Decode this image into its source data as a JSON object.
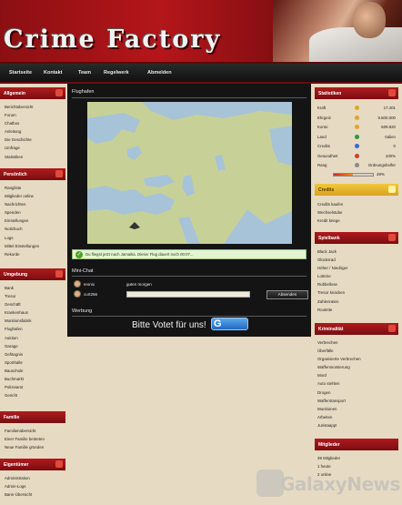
{
  "header": {
    "logo": "Crime Factory"
  },
  "nav": [
    "Startseite",
    "Kontakt",
    "Team",
    "Regelwerk",
    "Abmelden"
  ],
  "left": {
    "allgemein": {
      "title": "Allgemein",
      "items": [
        "Berichtübersicht",
        "Forum",
        "Chatbox",
        "Anleitung",
        "Die Geschichte",
        "Umfrage",
        "Statistiken"
      ]
    },
    "persoenlich": {
      "title": "Persönlich",
      "items": [
        "Rangliste",
        "Mitglieder online",
        "Nachrichten",
        "Spenden",
        "Einstellungen",
        "Notizbuch",
        "Logs",
        "Mittel Einstellungen",
        "Rekorde"
      ]
    },
    "umgebung": {
      "title": "Umgebung",
      "items": [
        "Bank",
        "Tresor",
        "Geschäft",
        "Krankenhaus",
        "Munitionsfabrik",
        "Flughafen",
        "Auktion",
        "Garage",
        "Gefängnis",
        "Sporthalle",
        "Bauschule",
        "Buchmarkt",
        "Polizeiamt",
        "Gericht"
      ]
    },
    "familie": {
      "title": "Familie",
      "items": [
        "Familienübersicht",
        "Einer Familie beitreten",
        "Neue Familie gründen"
      ]
    },
    "eigentuemer": {
      "title": "Eigentümer",
      "items": [
        "Administration",
        "Admin-Logs",
        "Bann-Übersicht"
      ]
    }
  },
  "center": {
    "flughafen_title": "Flughafen",
    "notice": "Du fliegst jetzt nach Jamaika. Dieser Flug dauert noch 00:07...",
    "minichat_title": "Mini-Chat",
    "chat": [
      {
        "user": "Ieonix",
        "message": "guten morgen"
      },
      {
        "user": "curt256",
        "message": ""
      }
    ],
    "send_label": "Absenden",
    "werbung_title": "Werbung",
    "vote_text": "Bitte Votet für uns!",
    "vote_badge": "G"
  },
  "right": {
    "statistiken": {
      "title": "Statistiken",
      "rows": [
        {
          "label": "Kraft",
          "value": "17.401",
          "icon_color": "#e0a820"
        },
        {
          "label": "Ehrgeiz",
          "value": "9.500.000",
          "icon_color": "#e0a820"
        },
        {
          "label": "Konto",
          "value": "609.820",
          "icon_color": "#e0a820"
        },
        {
          "label": "Land",
          "value": "Italien",
          "icon_color": "#2a9a3a"
        },
        {
          "label": "Credits",
          "value": "0",
          "icon_color": "#3a6ad0"
        },
        {
          "label": "Gesundheit",
          "value": "100%",
          "icon_color": "#d23a3a"
        },
        {
          "label": "Rang",
          "value": "Ordnungshelfer",
          "icon_color": "#8a8a8a"
        }
      ],
      "progress_label": "49%",
      "progress_value": 0.49
    },
    "credits": {
      "title": "Credits",
      "items": [
        "Credits kaufen",
        "Wechselstube",
        "Kredit kriege"
      ]
    },
    "spielbank": {
      "title": "Spielbank",
      "items": [
        "Black Jack",
        "Glücksrad",
        "Höher / Niedriger",
        "Lotterie",
        "Rubbellose",
        "Tresor knacken",
        "Zahlenraten",
        "Roulette"
      ]
    },
    "kriminalitaet": {
      "title": "Kriminalität",
      "items": [
        "Verbrechen",
        "Überfälle",
        "Organisierte Verbrechen",
        "Waffenmontierung",
        "Mord",
        "Auto stehlen",
        "Drogen",
        "Waffentransport",
        "Munitionen",
        "Arbeiten",
        "Juristaapp!"
      ]
    },
    "mitglieder": {
      "title": "Mitglieder",
      "items": [
        "39 Mitglieder",
        "1 heute",
        "2 online"
      ]
    }
  },
  "watermark": "GalaxyNews"
}
